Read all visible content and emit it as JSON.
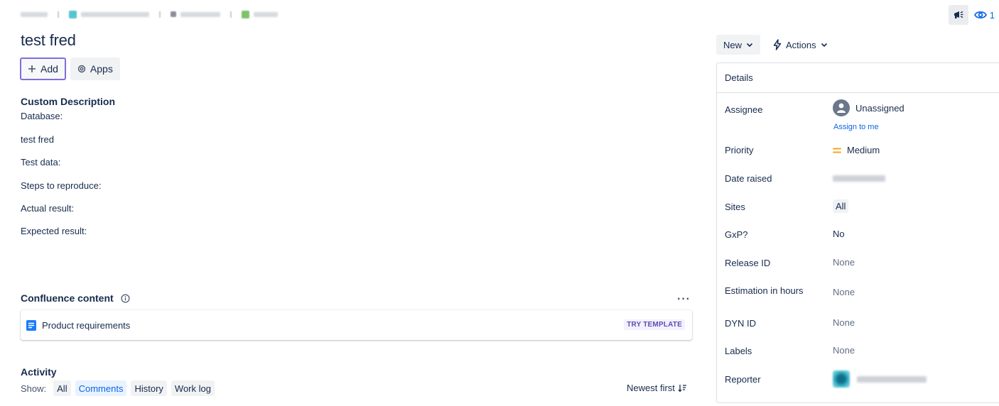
{
  "header": {
    "watch_count": "1"
  },
  "issue": {
    "title": "test fred"
  },
  "toolbar": {
    "add_label": "Add",
    "apps_label": "Apps"
  },
  "description": {
    "heading": "Custom Description",
    "lines": [
      "Database:",
      "test fred",
      "Test data:",
      "Steps to reproduce:",
      "Actual result:",
      "Expected result:"
    ]
  },
  "confluence": {
    "heading": "Confluence content",
    "more": "···",
    "item_name": "Product requirements",
    "item_action": "TRY TEMPLATE"
  },
  "activity": {
    "heading": "Activity",
    "show_label": "Show:",
    "filters": [
      "All",
      "Comments",
      "History",
      "Work log"
    ],
    "active_filter": "Comments",
    "sort_label": "Newest first"
  },
  "status_actions": {
    "status_label": "New",
    "actions_label": "Actions"
  },
  "details": {
    "heading": "Details",
    "fields": [
      {
        "label": "Assignee",
        "value": "Unassigned"
      },
      {
        "label": "Priority",
        "value": "Medium"
      },
      {
        "label": "Date raised",
        "value": ""
      },
      {
        "label": "Sites",
        "value": "All"
      },
      {
        "label": "GxP?",
        "value": "No"
      },
      {
        "label": "Release ID",
        "value": "None"
      },
      {
        "label": "Estimation in hours",
        "value": "None"
      },
      {
        "label": "DYN ID",
        "value": "None"
      },
      {
        "label": "Labels",
        "value": "None"
      },
      {
        "label": "Reporter",
        "value": ""
      }
    ],
    "assign_to_me": "Assign to me"
  },
  "colors": {
    "link_blue": "#0c66e4",
    "priority_medium": "#f5a623",
    "focus_purple": "#7f6fd9",
    "lozenge_text": "#5e4db2"
  }
}
